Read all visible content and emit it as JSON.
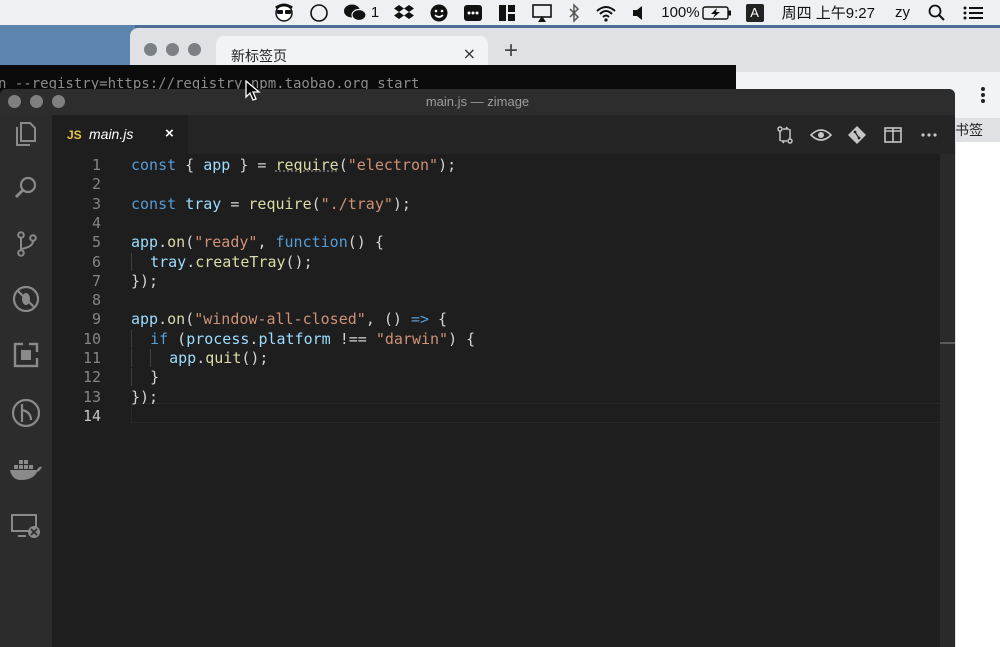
{
  "menubar": {
    "wechat_badge": "1",
    "battery": "100%",
    "input_method": "A",
    "clock": "周四 上午9:27",
    "user": "zy"
  },
  "chrome": {
    "tab_title": "新标签页",
    "tab_close": "×",
    "new_tab": "+",
    "bookmarks_label": "书签"
  },
  "terminal": {
    "command": "n --registry=https://registry.npm.taobao.org   start"
  },
  "vscode": {
    "title": "main.js — zimage",
    "tab": {
      "icon": "JS",
      "label": "main.js",
      "close": "×"
    },
    "lines": [
      {
        "n": "1",
        "t": [
          [
            "kw",
            "const"
          ],
          [
            "op",
            " { "
          ],
          [
            "var",
            "app"
          ],
          [
            "op",
            " } = "
          ],
          [
            "fnsq",
            "require"
          ],
          [
            "op",
            "("
          ],
          [
            "str",
            "\"electron\""
          ],
          [
            "op",
            ");"
          ]
        ]
      },
      {
        "n": "2",
        "t": []
      },
      {
        "n": "3",
        "t": [
          [
            "kw",
            "const"
          ],
          [
            "op",
            " "
          ],
          [
            "var",
            "tray"
          ],
          [
            "op",
            " = "
          ],
          [
            "fn",
            "require"
          ],
          [
            "op",
            "("
          ],
          [
            "str",
            "\"./tray\""
          ],
          [
            "op",
            ");"
          ]
        ]
      },
      {
        "n": "4",
        "t": []
      },
      {
        "n": "5",
        "t": [
          [
            "var",
            "app"
          ],
          [
            "op",
            "."
          ],
          [
            "fn",
            "on"
          ],
          [
            "op",
            "("
          ],
          [
            "str",
            "\"ready\""
          ],
          [
            "op",
            ", "
          ],
          [
            "kw",
            "function"
          ],
          [
            "op",
            "() {"
          ]
        ]
      },
      {
        "n": "6",
        "t": [
          [
            "guide",
            "  "
          ],
          [
            "var",
            "tray"
          ],
          [
            "op",
            "."
          ],
          [
            "fn",
            "createTray"
          ],
          [
            "op",
            "();"
          ]
        ]
      },
      {
        "n": "7",
        "t": [
          [
            "op",
            "});"
          ]
        ]
      },
      {
        "n": "8",
        "t": []
      },
      {
        "n": "9",
        "t": [
          [
            "var",
            "app"
          ],
          [
            "op",
            "."
          ],
          [
            "fn",
            "on"
          ],
          [
            "op",
            "("
          ],
          [
            "str",
            "\"window-all-closed\""
          ],
          [
            "op",
            ", () "
          ],
          [
            "arrow",
            "=>"
          ],
          [
            "op",
            " {"
          ]
        ]
      },
      {
        "n": "10",
        "t": [
          [
            "guide",
            "  "
          ],
          [
            "kw",
            "if"
          ],
          [
            "op",
            " ("
          ],
          [
            "var",
            "process"
          ],
          [
            "op",
            "."
          ],
          [
            "var",
            "platform"
          ],
          [
            "op",
            " !== "
          ],
          [
            "str",
            "\"darwin\""
          ],
          [
            "op",
            ") {"
          ]
        ]
      },
      {
        "n": "11",
        "t": [
          [
            "guide",
            "  "
          ],
          [
            "guide",
            "  "
          ],
          [
            "var",
            "app"
          ],
          [
            "op",
            "."
          ],
          [
            "fn",
            "quit"
          ],
          [
            "op",
            "();"
          ]
        ]
      },
      {
        "n": "12",
        "t": [
          [
            "guide",
            "  "
          ],
          [
            "op",
            "}"
          ]
        ]
      },
      {
        "n": "13",
        "t": [
          [
            "op",
            "});"
          ]
        ]
      },
      {
        "n": "14",
        "t": []
      }
    ],
    "active_line": "14"
  },
  "colors": {
    "keyword": "#569cd6",
    "variable": "#9cdcfe",
    "string": "#ce9178",
    "function": "#dcdcaa",
    "js_icon": "#e7c547"
  }
}
